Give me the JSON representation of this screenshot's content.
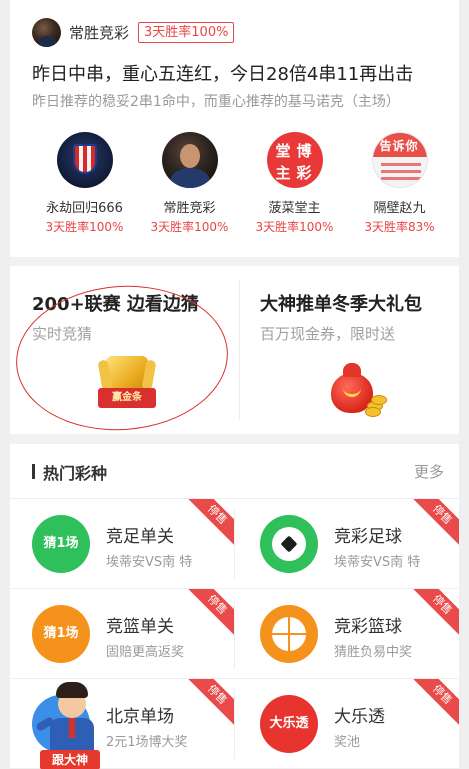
{
  "news": {
    "author": "常胜竞彩",
    "author_badge": "3天胜率100%",
    "headline": "昨日中串，重心五连红，今日28倍4串11再出击",
    "subline": "昨日推荐的稳妥2串1命中，而重心推荐的基马诺克（主场）"
  },
  "experts": [
    {
      "name": "永劫回归666",
      "rate": "3天胜率100%",
      "avatar": "atletico-crest"
    },
    {
      "name": "常胜竞彩",
      "rate": "3天胜率100%",
      "avatar": "person-photo"
    },
    {
      "name": "菠菜堂主",
      "rate": "3天胜率100%",
      "avatar": "red-logo"
    },
    {
      "name": "隔壁赵九",
      "rate": "3天胜率83%",
      "avatar": "notice-logo"
    }
  ],
  "expert_avatar_text": {
    "cai": [
      "堂",
      "博",
      "主",
      "彩"
    ],
    "gao": "告诉你"
  },
  "promos": {
    "left": {
      "title": "200+联赛 边看边猜",
      "subtitle": "实时竞猜",
      "icon_label": "赢金条"
    },
    "right": {
      "title": "大神推单冬季大礼包",
      "subtitle": "百万现金券，限时送"
    }
  },
  "hot": {
    "title": "热门彩种",
    "more": "更多",
    "stop_label": "停售",
    "items": [
      {
        "name": "竞足单关",
        "desc": "埃蒂安VS南 特",
        "icon_text": "猜1场",
        "color": "#2fbf5b"
      },
      {
        "name": "竞彩足球",
        "desc": "埃蒂安VS南 特",
        "icon": "soccer-ball-icon",
        "color": "#2fbf5b"
      },
      {
        "name": "竞篮单关",
        "desc": "固赔更高返奖",
        "icon_text": "猜1场",
        "color": "#f5921c"
      },
      {
        "name": "竞彩篮球",
        "desc": "猜胜负易中奖",
        "icon": "basketball-icon",
        "color": "#f5921c"
      },
      {
        "name": "北京单场",
        "desc": "2元1场博大奖",
        "color": "#3b8fe8"
      },
      {
        "name": "大乐透",
        "desc": "奖池",
        "icon_text": "大乐透",
        "color": "#e8342e"
      }
    ]
  },
  "mascot": {
    "tag": "跟大神"
  },
  "colors": {
    "accent_red": "#e84545",
    "ribbon": "#e94a4a",
    "annotation_circle": "#d9302a"
  }
}
